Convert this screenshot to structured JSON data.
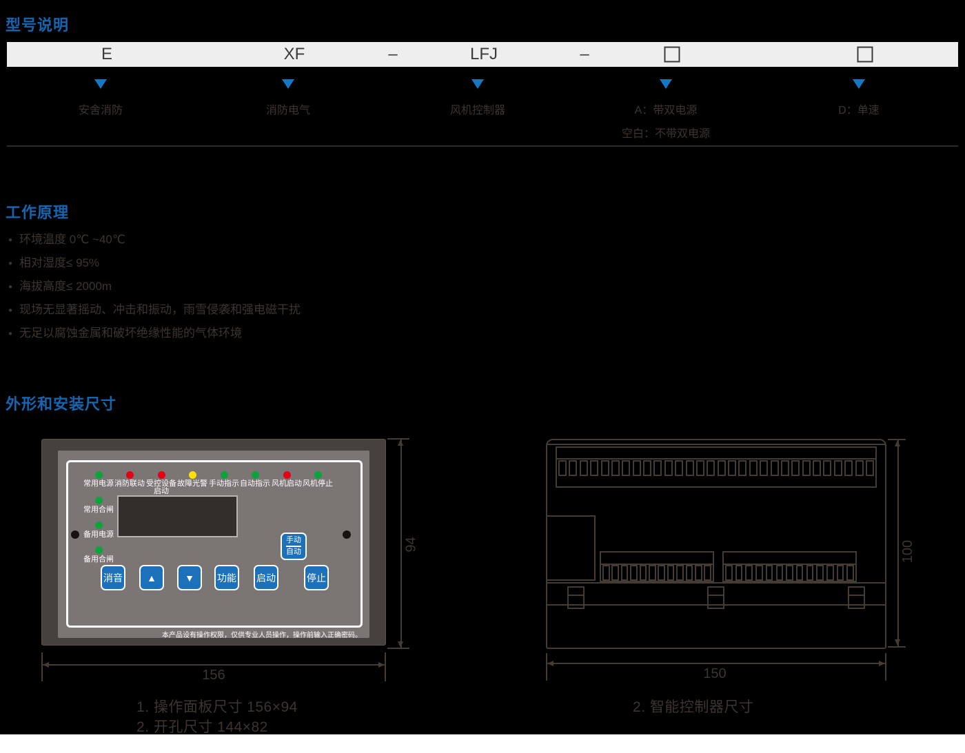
{
  "colors": {
    "heading": "#1566b1",
    "triangle": "#1277c5",
    "row_bg": "#efeeee",
    "row_ink": "#3b3b3b",
    "ink": "#3c3531",
    "line": "#453b35",
    "panel_frame": "#46403e",
    "panel_face": "#7b7573",
    "button_blue": "#1d70ba",
    "led_green": "#0ca33c",
    "led_red": "#e60016",
    "led_yellow": "#ffe100"
  },
  "model": {
    "title": "型号说明",
    "codes": [
      "E",
      "XF",
      "–",
      "LFJ",
      "–",
      "□",
      "□"
    ],
    "branches": [
      {
        "label": "安舍消防"
      },
      {
        "label": "消防电气"
      },
      {
        "label": "风机控制器"
      },
      {
        "label": "A：带双电源",
        "label2": "空白：不带双电源"
      },
      {
        "label": "D：单速"
      }
    ]
  },
  "working": {
    "title": "工作原理",
    "items": [
      "环境温度 0℃ ~40℃",
      "相对湿度≤ 95%",
      "海拔高度≤ 2000m",
      "现场无显著摇动、冲击和振动，雨雪侵袭和强电磁干扰",
      "无足以腐蚀金属和破坏绝缘性能的气体环境"
    ]
  },
  "dimensions_section": {
    "title": "外形和安装尺寸"
  },
  "panel": {
    "leds": [
      {
        "label": "常用电源",
        "color": "#0ca33c"
      },
      {
        "label": "消防联动",
        "color": "#e60016"
      },
      {
        "label": "受控设备\n启动",
        "color": "#e60016"
      },
      {
        "label": "故障光警",
        "color": "#ffe100"
      },
      {
        "label": "手动指示",
        "color": "#0ca33c"
      },
      {
        "label": "自动指示",
        "color": "#0ca33c"
      },
      {
        "label": "风机启动",
        "color": "#e60016"
      },
      {
        "label": "风机停止",
        "color": "#0ca33c"
      }
    ],
    "side_leds": [
      {
        "label": "常用合闸",
        "color": "#0ca33c"
      },
      {
        "label": "备用电源",
        "color": "#0ca33c"
      },
      {
        "label": "备用合闸",
        "color": "#0ca33c"
      }
    ],
    "manual_button": {
      "line1": "手动",
      "line2": "自动"
    },
    "buttons": [
      "消音",
      "▲",
      "▼",
      "功能",
      "启动",
      "停止"
    ],
    "notice": "本产品设有操作权限，仅供专业人员操作，操作前输入正确密码。"
  },
  "controller": {
    "top_terminals": 30,
    "group_terminals": [
      12,
      13
    ],
    "clips": 3
  },
  "dims": {
    "panel_height": "94",
    "panel_width": "156",
    "ctrl_height": "100",
    "ctrl_width": "150"
  },
  "captions": {
    "left1": "1. 操作面板尺寸 156×94",
    "left2": "2. 开孔尺寸 144×82",
    "right": "2. 智能控制器尺寸"
  }
}
